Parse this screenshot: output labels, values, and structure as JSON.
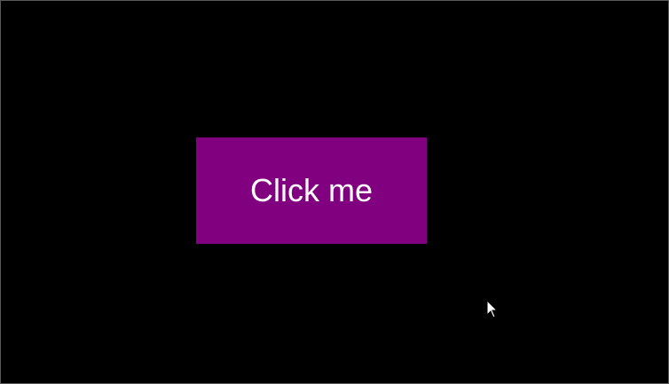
{
  "canvas": {
    "background_color": "#000000"
  },
  "button": {
    "label": "Click me",
    "background_color": "#800080",
    "text_color": "#ffffff"
  },
  "cursor": {
    "icon": "arrow-pointer-icon"
  }
}
